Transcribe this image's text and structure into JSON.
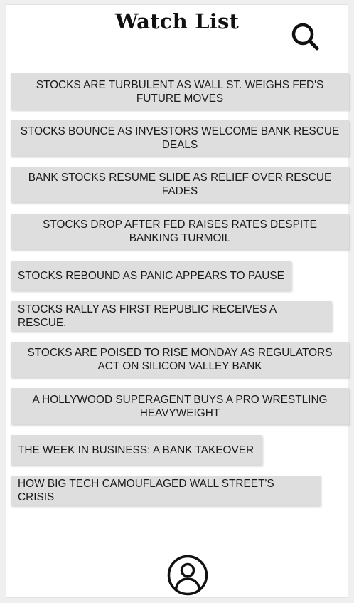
{
  "header": {
    "title": "Watch List"
  },
  "icons": {
    "search": "search-icon",
    "profile": "user-profile-icon"
  },
  "watchlist": {
    "items": [
      "STOCKS ARE TURBULENT AS WALL ST. WEIGHS FED'S FUTURE MOVES",
      "STOCKS BOUNCE AS INVESTORS WELCOME BANK RESCUE DEALS",
      "BANK STOCKS RESUME SLIDE AS RELIEF OVER RESCUE FADES",
      "STOCKS DROP AFTER FED RAISES RATES DESPITE BANKING TURMOIL",
      "STOCKS REBOUND AS PANIC APPEARS TO PAUSE",
      "STOCKS RALLY AS FIRST REPUBLIC RECEIVES A RESCUE.",
      "STOCKS ARE POISED TO RISE MONDAY AS REGULATORS ACT ON SILICON VALLEY BANK",
      "A HOLLYWOOD SUPERAGENT BUYS A PRO WRESTLING HEAVYWEIGHT",
      "THE WEEK IN BUSINESS: A BANK TAKEOVER",
      "HOW BIG TECH CAMOUFLAGED WALL STREET'S CRISIS"
    ]
  }
}
